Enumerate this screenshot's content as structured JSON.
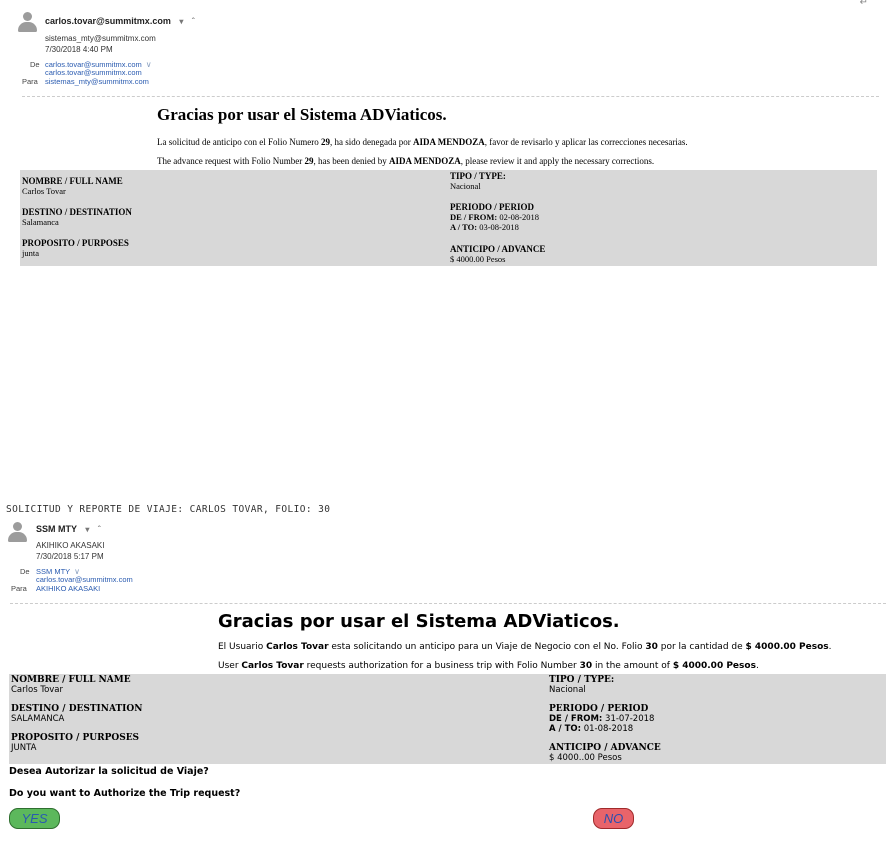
{
  "email1": {
    "sender": "carlos.tovar@summitmx.com",
    "to_short": "sistemas_mty@summitmx.com",
    "date": "7/30/2018 4:40 PM",
    "de_label": "De",
    "de_value": "carlos.tovar@summitmx.com",
    "de_value2": "carlos.tovar@summitmx.com",
    "para_label": "Para",
    "para_value": "sistemas_mty@summitmx.com",
    "title": "Gracias por usar el Sistema ADViaticos.",
    "line1": {
      "pre": "La solicitud de anticipo con el Folio Numero ",
      "folio": "29",
      "mid": ", ha sido denegada por ",
      "who": "AIDA MENDOZA",
      "post": ", favor de revisarlo y aplicar las correcciones necesarias."
    },
    "line2": {
      "pre": "The advance request with Folio Number ",
      "folio": "29",
      "mid": ", has been denied by ",
      "who": "AIDA MENDOZA",
      "post": ", please review it and apply the necessary corrections."
    },
    "fields": {
      "nombre_label": "NOMBRE / FULL NAME",
      "nombre_value": "Carlos Tovar",
      "destino_label": "DESTINO / DESTINATION",
      "destino_value": "Salamanca",
      "proposito_label": "PROPOSITO / PURPOSES",
      "proposito_value": "junta",
      "tipo_label": "TIPO / TYPE:",
      "tipo_value": "Nacional",
      "periodo_label": "PERIODO / PERIOD",
      "de_label": "DE / FROM:",
      "de_value": "02-08-2018",
      "a_label": "A / TO:",
      "a_value": "03-08-2018",
      "anticipo_label": "ANTICIPO / ADVANCE",
      "anticipo_value": "$ 4000.00 Pesos"
    }
  },
  "email2": {
    "subject": "SOLICITUD Y REPORTE DE VIAJE: CARLOS TOVAR, FOLIO: 30",
    "sender": "SSM MTY",
    "to_short": "AKIHIKO AKASAKI",
    "date": "7/30/2018 5:17 PM",
    "de_label": "De",
    "de_value": "SSM MTY",
    "de_value2": "carlos.tovar@summitmx.com",
    "para_label": "Para",
    "para_value": "AKIHIKO AKASAKI",
    "title": "Gracias por usar el Sistema ADViaticos.",
    "line1": {
      "pre": "El Usuario ",
      "who": "Carlos Tovar",
      "mid": " esta solicitando un anticipo para un Viaje de Negocio con el No. Folio ",
      "folio": "30",
      "mid2": " por la cantidad de ",
      "amount": "$ 4000.00 Pesos",
      "post": "."
    },
    "line2": {
      "pre": "User ",
      "who": "Carlos Tovar",
      "mid": " requests authorization for a business trip with Folio Number ",
      "folio": "30",
      "mid2": " in the amount of ",
      "amount": "$ 4000.00 Pesos",
      "post": "."
    },
    "fields": {
      "nombre_label": "NOMBRE / FULL NAME",
      "nombre_value": "Carlos Tovar",
      "destino_label": "DESTINO / DESTINATION",
      "destino_value": "SALAMANCA",
      "proposito_label": "PROPOSITO / PURPOSES",
      "proposito_value": "JUNTA",
      "tipo_label": "TIPO / TYPE:",
      "tipo_value": "Nacional",
      "periodo_label": "PERIODO / PERIOD",
      "de_label": "DE / FROM:",
      "de_value": "31-07-2018",
      "a_label": "A / TO:",
      "a_value": "01-08-2018",
      "anticipo_label": "ANTICIPO / ADVANCE",
      "anticipo_value": "$ 4000..00 Pesos"
    },
    "question_es": "Desea Autorizar la solicitud de Viaje?",
    "question_en": "Do you want to Authorize the Trip request?",
    "yes_label": "YES",
    "no_label": "NO"
  },
  "icons": {
    "avatar": "person-silhouette-icon",
    "dropdown": "chevron-down-icon",
    "expand": "double-chevron-icon"
  },
  "colors": {
    "link": "#2a5bb0",
    "field_box": "#d8d8d8",
    "yes_button": "#5cb85c",
    "no_button": "#e8646a"
  }
}
